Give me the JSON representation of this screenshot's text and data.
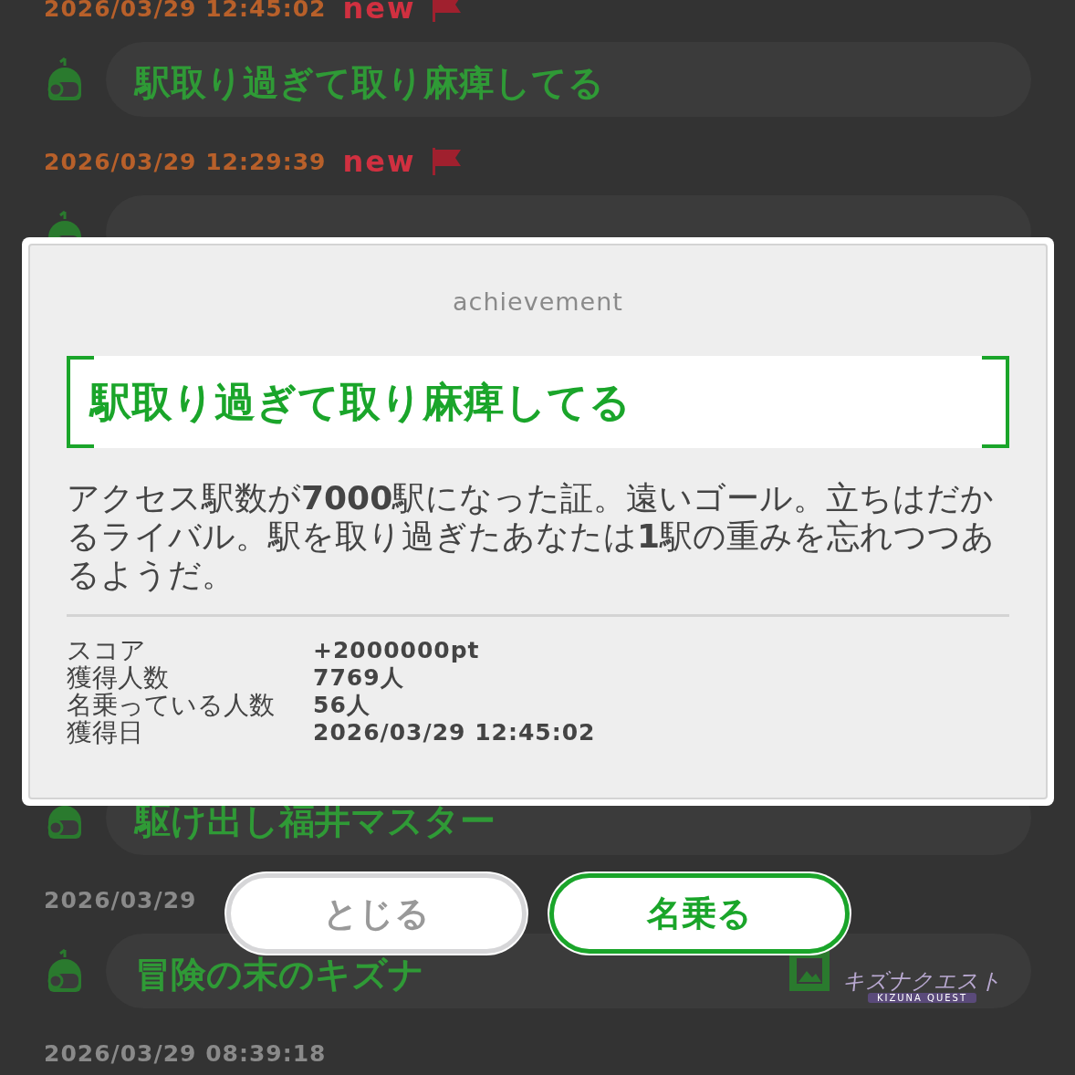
{
  "timeline": [
    {
      "date": "2026/03/29 12:45:02",
      "new": true,
      "badge": "new",
      "title": "駅取り過ぎて取り麻痺してる"
    },
    {
      "date": "2026/03/29 12:29:39",
      "new": true,
      "badge": "new"
    },
    {
      "title": "駆け出し福井マスター"
    },
    {
      "date": "2026/03/29",
      "new": false,
      "title": "冒険の末のキズナ",
      "logo": {
        "title": "キズナクエスト",
        "subtitle": "KIZUNA QUEST"
      }
    },
    {
      "date": "2026/03/29 08:39:18",
      "new": false
    }
  ],
  "dialog": {
    "heading": "achievement",
    "name": "駅取り過ぎて取り麻痺してる",
    "description": "アクセス駅数が**7000**駅になった証。遠いゴール。立ちはだかるライバル。駅を取り過ぎたあなたは**1**駅の重みを忘れつつあるようだ。",
    "stats": [
      {
        "label": "スコア",
        "value": "+2000000pt"
      },
      {
        "label": "獲得人数",
        "value": "7769人"
      },
      {
        "label": "名乗っている人数",
        "value": "56人"
      },
      {
        "label": "獲得日",
        "value": "2026/03/29 12:45:02"
      }
    ]
  },
  "buttons": [
    {
      "kind": "secondary",
      "label": "とじる"
    },
    {
      "kind": "primary",
      "label": "名乗る"
    }
  ]
}
